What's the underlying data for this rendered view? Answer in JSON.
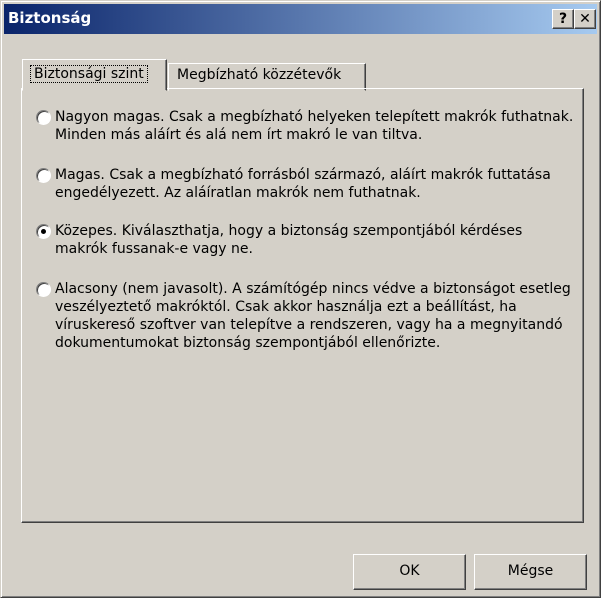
{
  "window": {
    "title": "Biztonság",
    "help_label": "?",
    "close_label": "✕"
  },
  "tabs": [
    {
      "label": "Biztonsági szint",
      "active": true
    },
    {
      "label": "Megbízható közzétevők",
      "active": false
    }
  ],
  "options": [
    {
      "text": "Nagyon magas. Csak a megbízható helyeken telepített makrók futhatnak. Minden más aláírt és alá nem írt makró le van tiltva.",
      "checked": false
    },
    {
      "text": "Magas. Csak a megbízható forrásból származó, aláírt makrók futtatása engedélyezett. Az aláíratlan makrók nem futhatnak.",
      "checked": false
    },
    {
      "text": "Közepes. Kiválaszthatja, hogy a biztonság szempontjából kérdéses makrók fussanak-e vagy ne.",
      "checked": true
    },
    {
      "text": "Alacsony (nem javasolt). A számítógép nincs védve a biztonságot esetleg veszélyeztető makróktól. Csak akkor használja ezt a beállítást, ha víruskereső szoftver van telepítve a rendszeren, vagy ha a megnyitandó dokumentumokat biztonság szempontjából ellenőrizte.",
      "checked": false
    }
  ],
  "buttons": {
    "ok": "OK",
    "cancel": "Mégse"
  },
  "colors": {
    "face": "#d4d0c8",
    "title_start": "#0a246a",
    "title_end": "#a6caf0"
  }
}
